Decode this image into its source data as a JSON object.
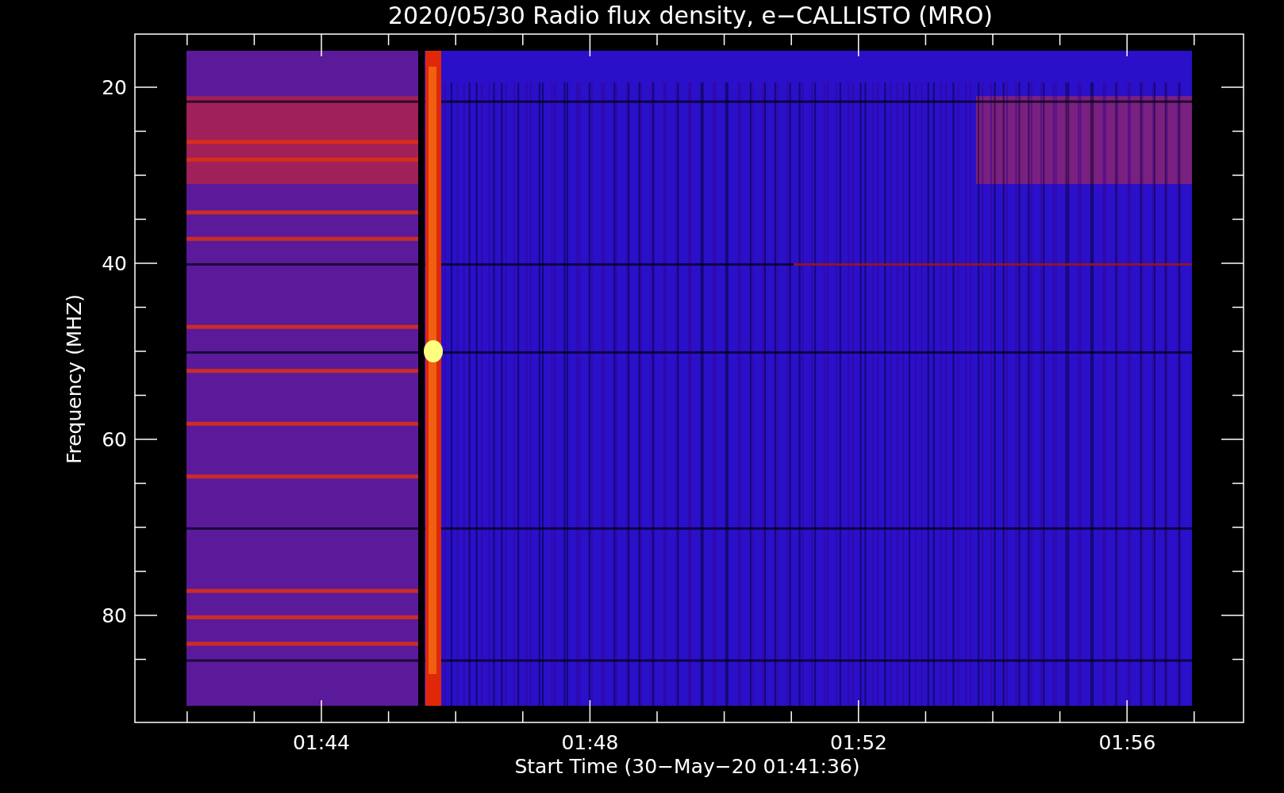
{
  "title": "2020/05/30  Radio flux density, e−CALLISTO (MRO)",
  "y_axis": {
    "label": "Frequency (MHZ)",
    "ticks": [
      "20",
      "40",
      "60",
      "80"
    ]
  },
  "x_axis": {
    "label": "Start Time (30−May−20 01:41:36)",
    "ticks": [
      "01:44",
      "01:48",
      "01:52",
      "01:56"
    ]
  }
}
